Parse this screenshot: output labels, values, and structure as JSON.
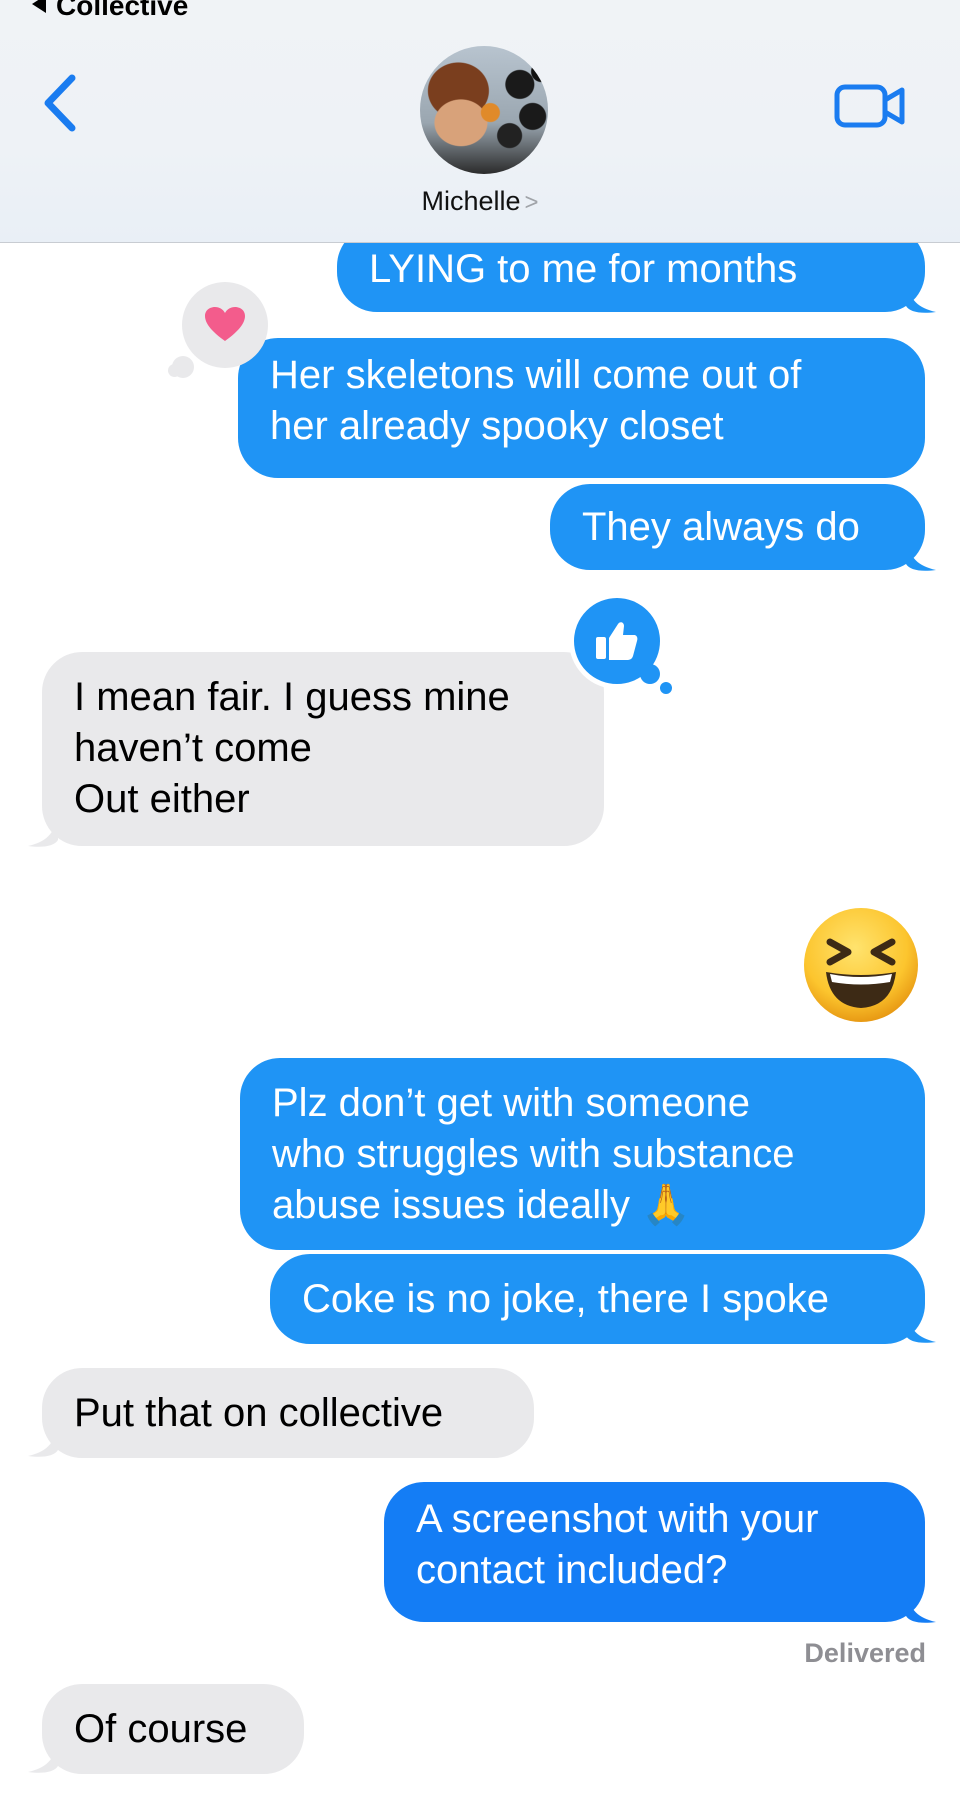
{
  "header": {
    "back_app_label": "Collective",
    "contact_name": "Michelle",
    "contact_chevron": ">"
  },
  "messages": [
    {
      "direction": "outgoing",
      "lines": [
        "LYING to me for months"
      ]
    },
    {
      "direction": "outgoing",
      "lines": [
        "Her skeletons will come out of",
        "her already spooky closet"
      ],
      "reaction": "heart"
    },
    {
      "direction": "outgoing",
      "lines": [
        "They always do"
      ]
    },
    {
      "direction": "incoming",
      "lines": [
        "I mean fair. I guess mine",
        "haven’t come",
        "Out either"
      ],
      "reaction": "thumbs-up"
    },
    {
      "direction": "outgoing",
      "type": "emoji",
      "emoji": "grinning-squinting-face"
    },
    {
      "direction": "outgoing",
      "lines": [
        "Plz don’t get with someone",
        "who struggles with substance",
        "abuse issues ideally 🙏"
      ]
    },
    {
      "direction": "outgoing",
      "lines": [
        "Coke is no joke, there I spoke"
      ]
    },
    {
      "direction": "incoming",
      "lines": [
        "Put that on collective"
      ]
    },
    {
      "direction": "outgoing",
      "lines": [
        "A screenshot with your",
        "contact included?"
      ]
    },
    {
      "direction": "incoming",
      "lines": [
        "Of course"
      ]
    }
  ],
  "status": {
    "delivered": "Delivered"
  },
  "colors": {
    "outgoing_bubble": "#1f94f5",
    "incoming_bubble": "#e9e9eb",
    "accent": "#1a7cf0",
    "heart": "#f35c8c"
  }
}
